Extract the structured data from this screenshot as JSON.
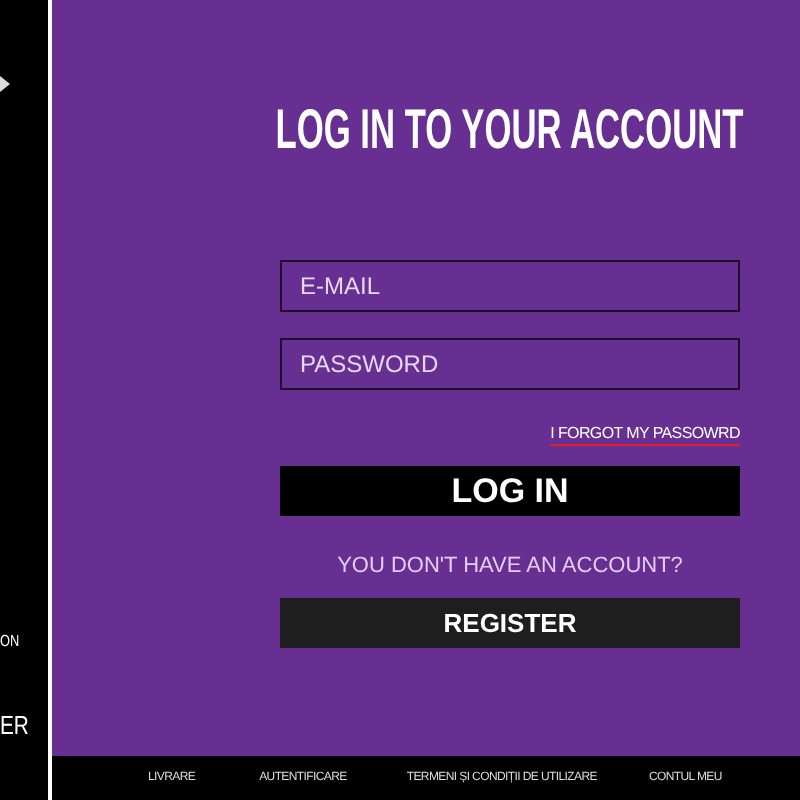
{
  "sidebar": {
    "items": [
      {
        "label": "ON"
      },
      {
        "label": "ER"
      }
    ]
  },
  "login": {
    "title": "LOG IN TO YOUR ACCOUNT",
    "fields": [
      {
        "placeholder": "E-MAIL"
      },
      {
        "placeholder": "PASSWORD"
      }
    ],
    "forgot_link": "I FORGOT MY PASSOWRD",
    "login_button": "LOG IN",
    "no_account_text": "YOU DON'T HAVE AN ACCOUNT?",
    "register_button": "REGISTER"
  },
  "footer": {
    "links": [
      "LIVRARE",
      "AUTENTIFICARE",
      "TERMENI ȘI CONDIȚII DE UTILIZARE",
      "CONTUL MEU"
    ]
  }
}
